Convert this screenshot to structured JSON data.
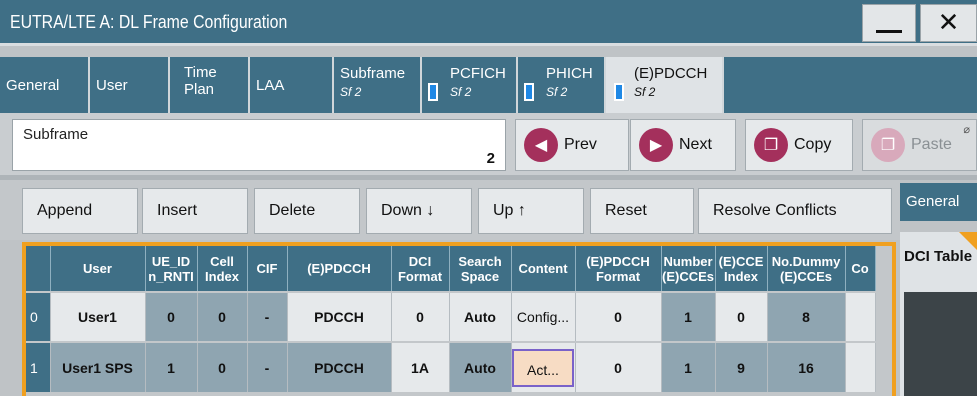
{
  "window": {
    "title": "EUTRA/LTE A: DL Frame Configuration",
    "minimize_glyph": "_",
    "close_glyph": "✕"
  },
  "tabs": [
    {
      "label": "General"
    },
    {
      "label": "User"
    },
    {
      "label": "Time Plan",
      "line1": "Time",
      "line2": "Plan"
    },
    {
      "label": "LAA"
    },
    {
      "label": "Subframe",
      "sub": "Sf 2"
    },
    {
      "label": "PCFICH",
      "sub": "Sf 2"
    },
    {
      "label": "PHICH",
      "sub": "Sf 2"
    },
    {
      "label": "(E)PDCCH",
      "sub": "Sf 2"
    }
  ],
  "subframe": {
    "label": "Subframe",
    "value": "2"
  },
  "nav_buttons": {
    "prev": "Prev",
    "next": "Next",
    "copy": "Copy",
    "paste": "Paste"
  },
  "toolbar": {
    "append": "Append",
    "insert": "Insert",
    "delete": "Delete",
    "down": "Down ↓",
    "up": "Up ↑",
    "reset": "Reset",
    "resolve": "Resolve Conflicts"
  },
  "right_panel": {
    "general_tab": "General",
    "dci_table": "DCI Table"
  },
  "table": {
    "columns": [
      "",
      "User",
      "UE_ID n_RNTI",
      "Cell Index",
      "CIF",
      "(E)PDCCH",
      "DCI Format",
      "Search Space",
      "Content",
      "(E)PDCCH Format",
      "Number (E)CCEs",
      "(E)CCE Index",
      "No.Dummy (E)CCEs",
      "Co"
    ],
    "rows": [
      [
        "0",
        "User1",
        "0",
        "0",
        "-",
        "PDCCH",
        "0",
        "Auto",
        "Config...",
        "0",
        "1",
        "0",
        "8",
        ""
      ],
      [
        "1",
        "User1 SPS",
        "1",
        "0",
        "-",
        "PDCCH",
        "1A",
        "Auto",
        "Act...",
        "0",
        "1",
        "9",
        "16",
        ""
      ]
    ]
  },
  "colors": {
    "header_bg": "#3f6f86",
    "accent_orange": "#f0a020",
    "button_magenta": "#a4305c"
  }
}
